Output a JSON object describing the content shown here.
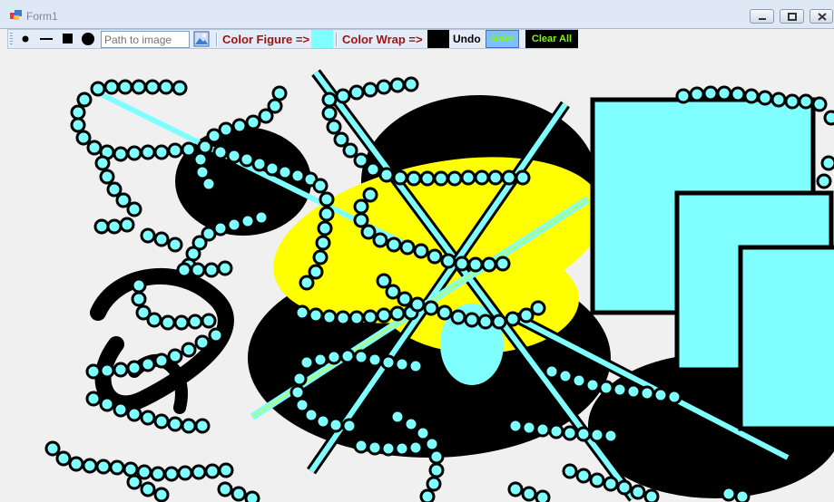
{
  "window": {
    "title": "Form1"
  },
  "toolbar": {
    "path_placeholder": "Path to image",
    "color_figure_label": "Color Figure =>",
    "color_wrap_label": "Color Wrap =>",
    "figure_color": "#7fffff",
    "wrap_color": "#000000",
    "undo_label": "Undo",
    "save_label": "Save",
    "clear_label": "Clear All",
    "tools": [
      "small-dot-icon",
      "line-icon",
      "square-icon",
      "large-dot-icon",
      "image-icon"
    ]
  }
}
